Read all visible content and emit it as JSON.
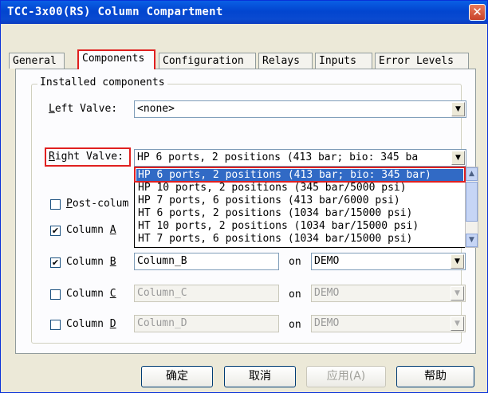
{
  "window": {
    "title": "TCC-3x00(RS) Column Compartment",
    "close_symbol": "✕"
  },
  "tabs": [
    {
      "label": "General"
    },
    {
      "label": "Components"
    },
    {
      "label": "Configuration"
    },
    {
      "label": "Relays"
    },
    {
      "label": "Inputs"
    },
    {
      "label": "Error Levels"
    }
  ],
  "group": {
    "legend": "Installed components"
  },
  "left_valve": {
    "label_prefix": "L",
    "label_rest": "eft Valve:",
    "value": "<none>"
  },
  "right_valve": {
    "label_prefix": "R",
    "label_rest": "ight Valve:",
    "value": "HP 6 ports, 2 positions (413 bar; bio: 345 ba"
  },
  "right_valve_options": [
    "HP 6 ports, 2 positions (413 bar; bio: 345 bar)",
    "HP 10 ports, 2 positions (345 bar/5000 psi)",
    "HP 7 ports, 6 positions (413 bar/6000 psi)",
    "HT 6 ports, 2 positions (1034 bar/15000 psi)",
    "HT 10 ports, 2 positions (1034 bar/15000 psi)",
    "HT 7 ports, 6 positions (1034 bar/15000 psi)"
  ],
  "post_column": {
    "label_prefix": "P",
    "label_rest": "ost-colum",
    "checked": false
  },
  "columns": [
    {
      "label": "Column ",
      "letter": "A",
      "checked": true,
      "name": "",
      "on": "on",
      "server": "",
      "enabled": true
    },
    {
      "label": "Column ",
      "letter": "B",
      "checked": true,
      "name": "Column_B",
      "on": "on",
      "server": "DEMO",
      "enabled": true
    },
    {
      "label": "Column ",
      "letter": "C",
      "checked": false,
      "name": "Column_C",
      "on": "on",
      "server": "DEMO",
      "enabled": false
    },
    {
      "label": "Column ",
      "letter": "D",
      "checked": false,
      "name": "Column_D",
      "on": "on",
      "server": "DEMO",
      "enabled": false
    }
  ],
  "check_mark": "✔",
  "icons": {
    "dropdown_arrow": "▼",
    "scroll_up": "▲",
    "scroll_down": "▼"
  },
  "buttons": {
    "ok": "确定",
    "cancel": "取消",
    "apply": "应用(A)",
    "help": "帮助"
  },
  "colors": {
    "title_bar": "#0245cf",
    "highlight": "#316ac5",
    "red_annotation": "#e02020"
  }
}
